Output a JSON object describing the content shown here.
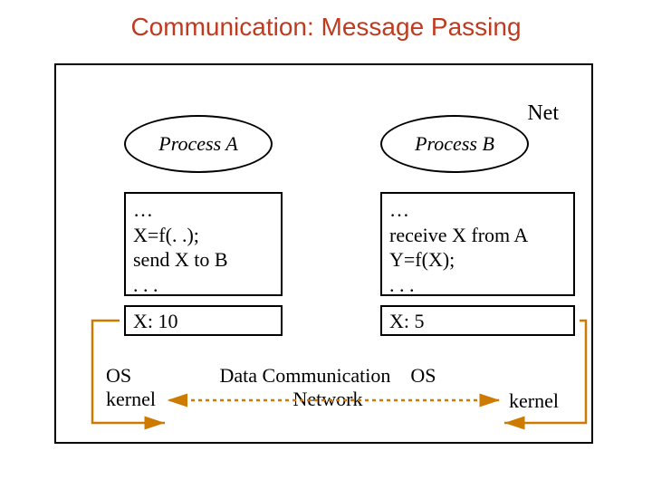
{
  "title": "Communication: Message Passing",
  "net_label": "Net",
  "process_a": {
    "name": "Process A",
    "code": "…\nX=f(. .);\nsend X to B\n. . .",
    "xval": "X: 10"
  },
  "process_b": {
    "name": "Process B",
    "code": "…\nreceive X from A\nY=f(X);\n. . .",
    "xval": "X: 5"
  },
  "kernel_a": "OS\nkernel",
  "kernel_b": "kernel",
  "datacomm": "Data Communication    OS\nNetwork"
}
